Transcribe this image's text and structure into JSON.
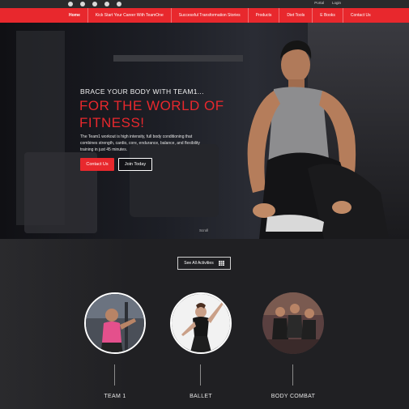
{
  "utility": {
    "social_icons": [
      "instagram-icon",
      "facebook-icon",
      "twitter-icon",
      "rss-icon",
      "pinterest-icon"
    ],
    "links": [
      "Portal",
      "Login"
    ]
  },
  "nav": {
    "items": [
      "Home",
      "Kick Start Your Career With TeamOne",
      "Successful Transformation Stories",
      "Products",
      "Diet Tools",
      "E Books",
      "Contact Us"
    ],
    "active_index": 0
  },
  "hero": {
    "kicker": "BRACE YOUR BODY WITH TEAM1...",
    "title": "FOR THE WORLD OF FITNESS!",
    "description": "The Team1 workout is high intensity, full body conditioning that combines strength, cardio, core, endurance, balance, and flexibility training in just 45 minutes.",
    "contact_button": "Contact Us",
    "join_button": "Join Today",
    "scroll_label": "Scroll"
  },
  "activities": {
    "see_all_label": "See All Activities",
    "items": [
      {
        "name": "TEAM 1"
      },
      {
        "name": "BALLET"
      },
      {
        "name": "BODY COMBAT"
      }
    ]
  },
  "colors": {
    "accent": "#e8282d",
    "background": "#1c1c1e"
  }
}
